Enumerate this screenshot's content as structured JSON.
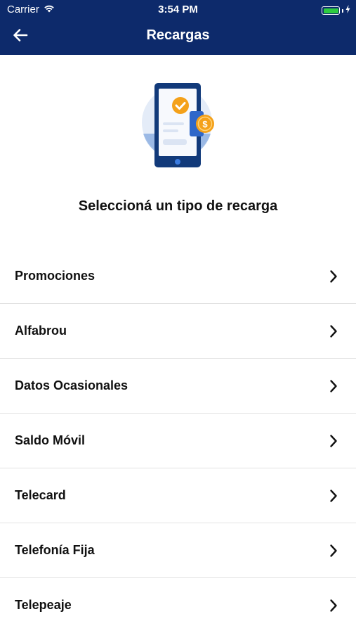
{
  "status_bar": {
    "carrier": "Carrier",
    "time": "3:54 PM",
    "battery_level": 1.0,
    "battery_color": "#2ecc40"
  },
  "nav": {
    "title": "Recargas",
    "back_icon": "arrow-left-icon",
    "background_color": "#0d2a6b"
  },
  "hero": {
    "illustration_icon": "phone-payment-icon",
    "subtitle": "Seleccioná un tipo de recarga"
  },
  "list": {
    "chevron_icon": "chevron-right-icon",
    "items": [
      {
        "label": "Promociones"
      },
      {
        "label": "Alfabrou"
      },
      {
        "label": "Datos Ocasionales"
      },
      {
        "label": "Saldo Móvil"
      },
      {
        "label": "Telecard"
      },
      {
        "label": "Telefonía Fija"
      },
      {
        "label": "Telepeaje"
      }
    ]
  }
}
